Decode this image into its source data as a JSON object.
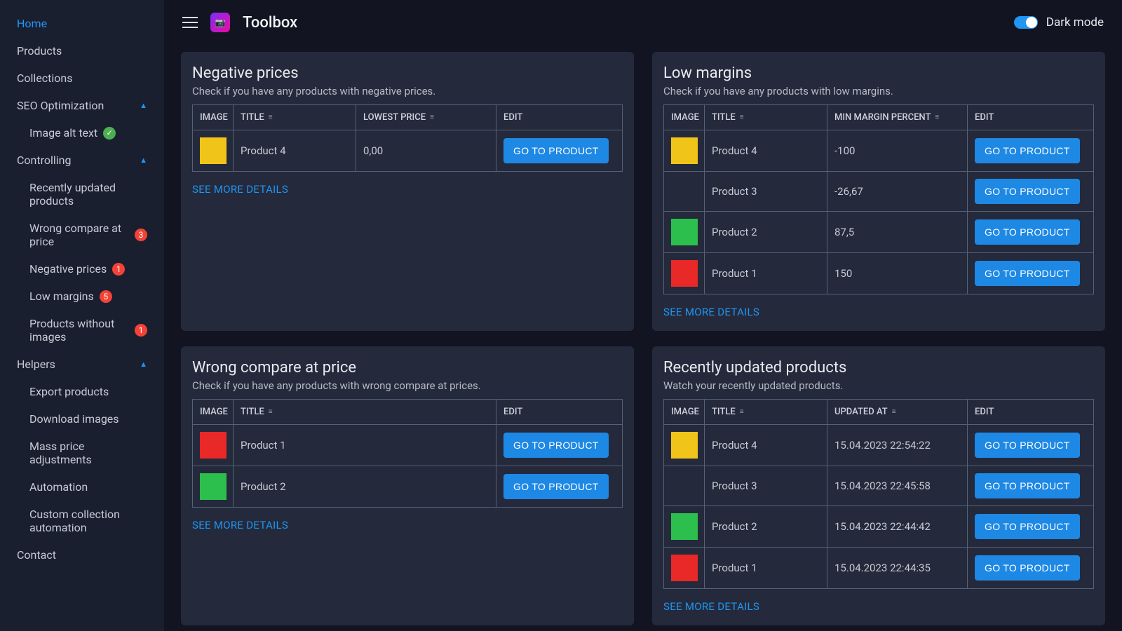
{
  "header": {
    "app_title": "Toolbox",
    "dark_mode_label": "Dark mode"
  },
  "sidebar": {
    "home": "Home",
    "products": "Products",
    "collections": "Collections",
    "seo": "SEO Optimization",
    "image_alt_text": "Image alt text",
    "controlling": "Controlling",
    "recently_updated": "Recently updated products",
    "wrong_compare": "Wrong compare at price",
    "wrong_compare_badge": "3",
    "negative_prices": "Negative prices",
    "negative_prices_badge": "1",
    "low_margins": "Low margins",
    "low_margins_badge": "5",
    "products_wo_images": "Products without images",
    "products_wo_images_badge": "1",
    "helpers": "Helpers",
    "export_products": "Export products",
    "download_images": "Download images",
    "mass_price": "Mass price adjustments",
    "automation": "Automation",
    "custom_collection": "Custom collection automation",
    "contact": "Contact"
  },
  "common": {
    "go_to_product": "GO TO PRODUCT",
    "see_more": "SEE MORE DETAILS",
    "th_image": "IMAGE",
    "th_title": "TITLE",
    "th_edit": "EDIT"
  },
  "cards": {
    "negative_prices": {
      "title": "Negative prices",
      "subtitle": "Check if you have any products with negative prices.",
      "th_lowest_price": "LOWEST PRICE",
      "rows": [
        {
          "color": "#f0c419",
          "title": "Product 4",
          "price": "0,00"
        }
      ]
    },
    "low_margins": {
      "title": "Low margins",
      "subtitle": "Check if you have any products with low margins.",
      "th_min_margin": "MIN MARGIN PERCENT",
      "rows": [
        {
          "color": "#f0c419",
          "title": "Product 4",
          "margin": "-100"
        },
        {
          "color": "",
          "title": "Product 3",
          "margin": "-26,67"
        },
        {
          "color": "#2cbf4e",
          "title": "Product 2",
          "margin": "87,5"
        },
        {
          "color": "#e92828",
          "title": "Product 1",
          "margin": "150"
        }
      ]
    },
    "wrong_compare": {
      "title": "Wrong compare at price",
      "subtitle": "Check if you have any products with wrong compare at prices.",
      "rows": [
        {
          "color": "#e92828",
          "title": "Product 1"
        },
        {
          "color": "#2cbf4e",
          "title": "Product 2"
        }
      ]
    },
    "recently_updated": {
      "title": "Recently updated products",
      "subtitle": "Watch your recently updated products.",
      "th_updated_at": "UPDATED AT",
      "rows": [
        {
          "color": "#f0c419",
          "title": "Product 4",
          "updated": "15.04.2023 22:54:22"
        },
        {
          "color": "",
          "title": "Product 3",
          "updated": "15.04.2023 22:45:58"
        },
        {
          "color": "#2cbf4e",
          "title": "Product 2",
          "updated": "15.04.2023 22:44:42"
        },
        {
          "color": "#e92828",
          "title": "Product 1",
          "updated": "15.04.2023 22:44:35"
        }
      ]
    }
  }
}
